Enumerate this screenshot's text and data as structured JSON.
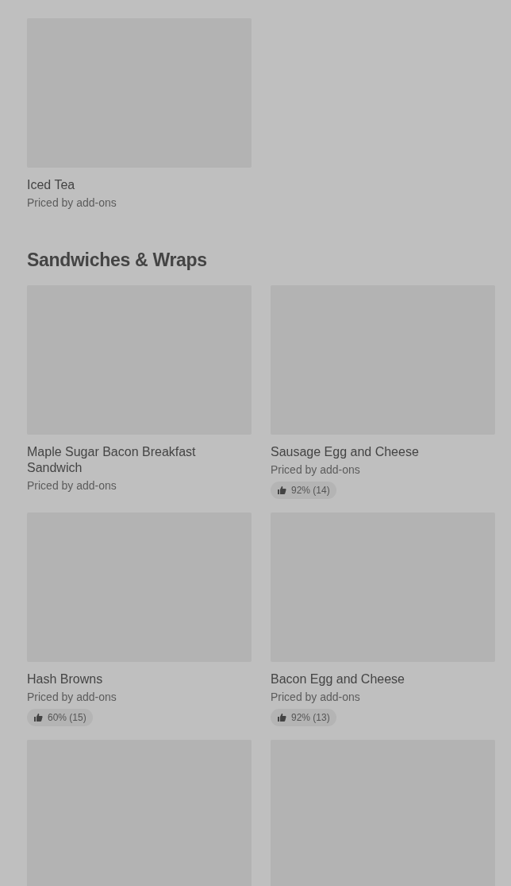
{
  "sections": [
    {
      "items": [
        {
          "kind": "item",
          "name": "Iced Tea",
          "price": "Priced by add-ons"
        }
      ]
    },
    {
      "title": "Sandwiches & Wraps",
      "items": [
        {
          "kind": "item",
          "name": "Maple Sugar Bacon Breakfast Sandwich",
          "price": "Priced by add-ons"
        },
        {
          "kind": "item",
          "name": "Sausage Egg and Cheese",
          "price": "Priced by add-ons",
          "rating": "92% (14)"
        },
        {
          "kind": "item",
          "name": "Hash Browns",
          "price": "Priced by add-ons",
          "rating": "60% (15)"
        },
        {
          "kind": "item",
          "name": "Bacon Egg and Cheese",
          "price": "Priced by add-ons",
          "rating": "92% (13)"
        },
        {
          "kind": "image-only"
        },
        {
          "kind": "image-only"
        }
      ]
    }
  ]
}
